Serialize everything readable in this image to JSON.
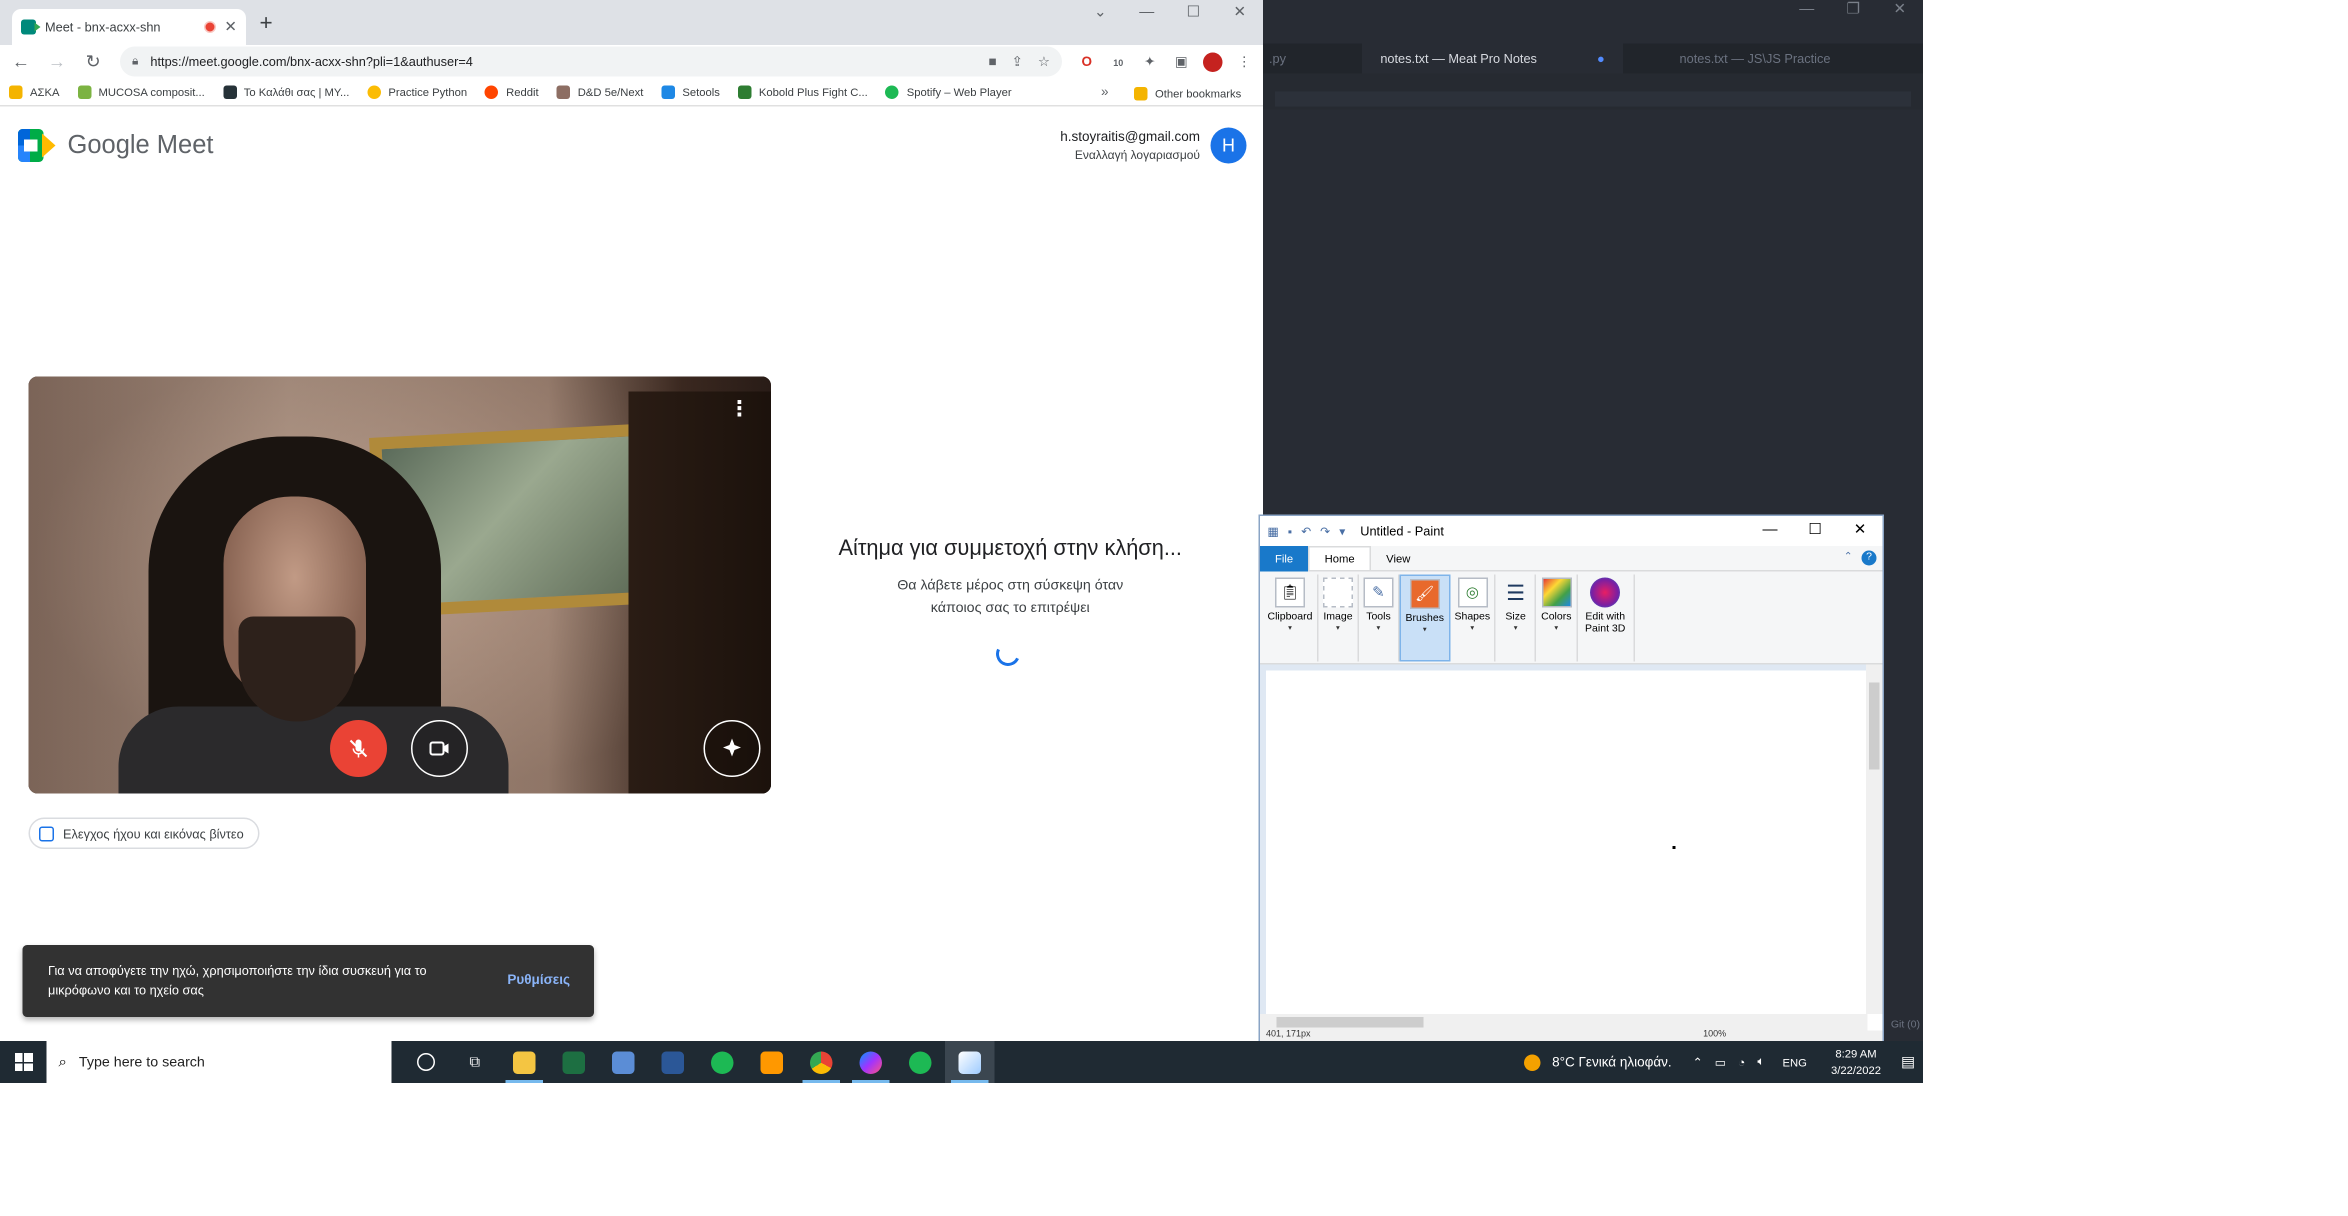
{
  "editor": {
    "tabs": [
      ".py",
      "notes.txt — Meat Pro Notes",
      "notes.txt — JS\\JS Practice"
    ],
    "status_right": "Git (0)"
  },
  "chrome": {
    "tab_title": "Meet - bnx-acxx-shn",
    "url": "https://meet.google.com/bnx-acxx-shn?pli=1&authuser=4",
    "extension_badge": "10",
    "bookmarks": [
      {
        "label": "ΑΣΚΑ",
        "color": "#f4b400"
      },
      {
        "label": "MUCOSA composit...",
        "color": "#7cb342"
      },
      {
        "label": "Το Καλάθι σας | MY...",
        "color": "#263238"
      },
      {
        "label": "Practice Python",
        "color": "#fbbc04"
      },
      {
        "label": "Reddit",
        "color": "#ff4500"
      },
      {
        "label": "D&D 5e/Next",
        "color": "#8d6e63"
      },
      {
        "label": "Setools",
        "color": "#1e88e5"
      },
      {
        "label": "Kobold Plus Fight C...",
        "color": "#2e7d32"
      },
      {
        "label": "Spotify – Web Player",
        "color": "#1db954"
      }
    ],
    "other_bookmarks": "Other bookmarks"
  },
  "meet": {
    "logo_text": "Google Meet",
    "account_email": "h.stoyraitis@gmail.com",
    "switch_account": "Εναλλαγή λογαριασμού",
    "avatar_letter": "H",
    "check_av": "Ελεγχος ήχου και εικόνας βίντεο",
    "join_heading": "Αίτημα για συμμετοχή στην κλήση...",
    "join_sub_1": "Θα λάβετε μέρος στη σύσκεψη όταν",
    "join_sub_2": "κάποιος σας το επιτρέψει",
    "toast_text": "Για να αποφύγετε την ηχώ, χρησιμοποιήστε την ίδια συσκευή για το μικρόφωνο και το ηχείο σας",
    "toast_action": "Ρυθμίσεις"
  },
  "paint": {
    "title": "Untitled - Paint",
    "menu": [
      "File",
      "Home",
      "View"
    ],
    "groups": [
      {
        "label": "Clipboard",
        "icon": "clipboard-icon"
      },
      {
        "label": "Image",
        "icon": "image-icon"
      },
      {
        "label": "Tools",
        "icon": "tools-icon"
      },
      {
        "label": "Brushes",
        "icon": "brushes-icon"
      },
      {
        "label": "Shapes",
        "icon": "shapes-icon"
      },
      {
        "label": "Size",
        "icon": "size-icon"
      },
      {
        "label": "Colors",
        "icon": "colors-icon"
      },
      {
        "label": "Edit with Paint 3D",
        "icon": "paint3d-icon"
      }
    ],
    "status_coords": "401, 171px",
    "zoom": "100%"
  },
  "taskbar": {
    "search_placeholder": "Type here to search",
    "weather": "8°C  Γενικά ηλιοφάν.",
    "lang": "ENG",
    "time": "8:29 AM",
    "date": "3/22/2022"
  }
}
